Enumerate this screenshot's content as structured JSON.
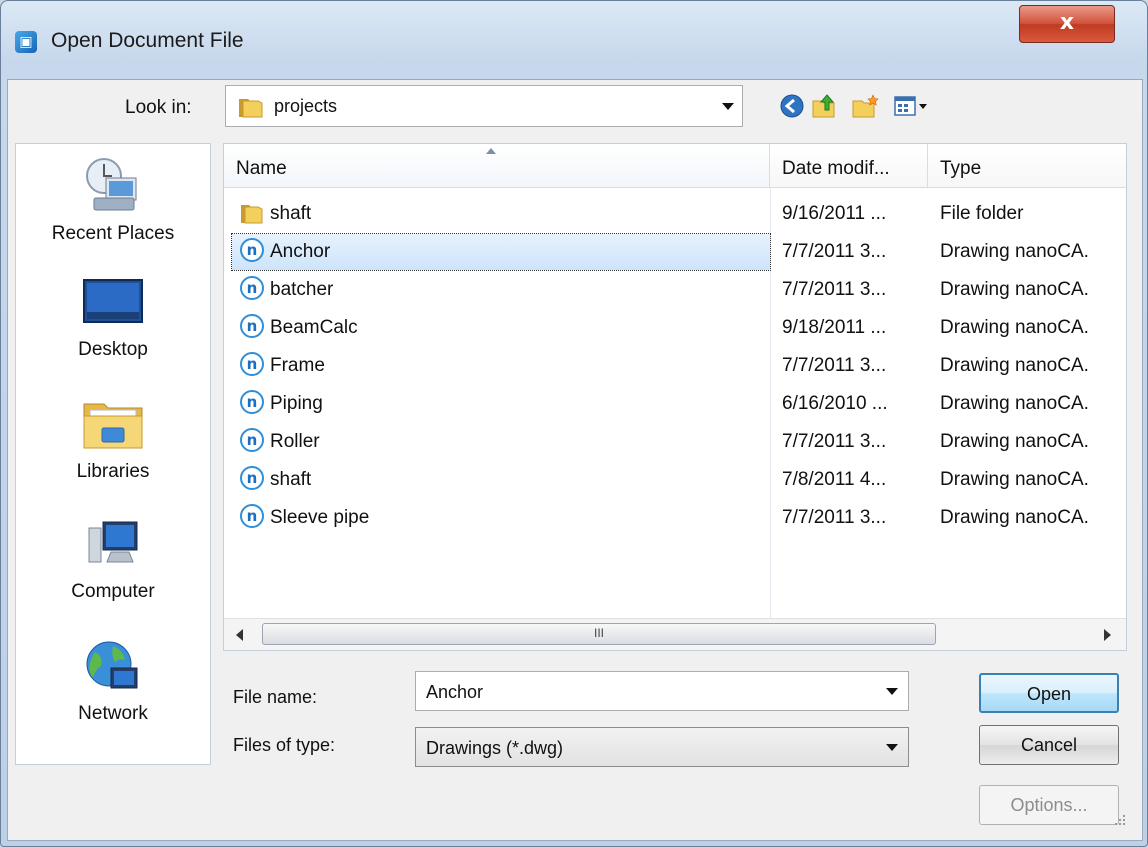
{
  "window": {
    "title": "Open Document File",
    "close_glyph": "x"
  },
  "lookin": {
    "label": "Look in:",
    "value": "projects"
  },
  "toolbar": [
    {
      "name": "back-icon",
      "title": "Back"
    },
    {
      "name": "up-folder-icon",
      "title": "Up One Level"
    },
    {
      "name": "new-folder-icon",
      "title": "Create New Folder"
    },
    {
      "name": "view-menu-icon",
      "title": "View Menu"
    }
  ],
  "places": [
    {
      "id": "recent-places",
      "label": "Recent Places"
    },
    {
      "id": "desktop",
      "label": "Desktop"
    },
    {
      "id": "libraries",
      "label": "Libraries"
    },
    {
      "id": "computer",
      "label": "Computer"
    },
    {
      "id": "network",
      "label": "Network"
    }
  ],
  "columns": {
    "name": "Name",
    "date": "Date modif...",
    "type": "Type"
  },
  "files": [
    {
      "name": "shaft",
      "date": "9/16/2011 ...",
      "type": "File folder",
      "icon": "folder-icon"
    },
    {
      "name": "Anchor",
      "date": "7/7/2011 3...",
      "type": "Drawing nanoCA.",
      "icon": "nanocad-file-icon"
    },
    {
      "name": "batcher",
      "date": "7/7/2011 3...",
      "type": "Drawing nanoCA.",
      "icon": "nanocad-file-icon"
    },
    {
      "name": "BeamCalc",
      "date": "9/18/2011 ...",
      "type": "Drawing nanoCA.",
      "icon": "nanocad-file-icon"
    },
    {
      "name": "Frame",
      "date": "7/7/2011 3...",
      "type": "Drawing nanoCA.",
      "icon": "nanocad-file-icon"
    },
    {
      "name": "Piping",
      "date": "6/16/2010 ...",
      "type": "Drawing nanoCA.",
      "icon": "nanocad-file-icon"
    },
    {
      "name": "Roller",
      "date": "7/7/2011 3...",
      "type": "Drawing nanoCA.",
      "icon": "nanocad-file-icon"
    },
    {
      "name": "shaft",
      "date": "7/8/2011 4...",
      "type": "Drawing nanoCA.",
      "icon": "nanocad-file-icon"
    },
    {
      "name": "Sleeve pipe",
      "date": "7/7/2011 3...",
      "type": "Drawing nanoCA.",
      "icon": "nanocad-file-icon"
    }
  ],
  "selected_file": "Anchor",
  "filename": {
    "label": "File name:",
    "value": "Anchor"
  },
  "filetype": {
    "label": "Files of type:",
    "value": "Drawings (*.dwg)"
  },
  "buttons": {
    "open": "Open",
    "cancel": "Cancel",
    "options": "Options..."
  },
  "scrollbar": {
    "thumb_glyph": "III"
  },
  "colors": {
    "selection": "#cde4fb",
    "accent": "#3c7fb1",
    "close": "#c8432a"
  }
}
